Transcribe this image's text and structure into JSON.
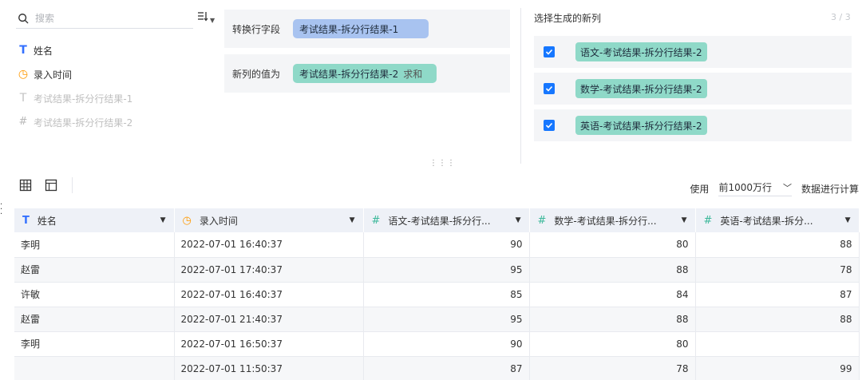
{
  "search": {
    "placeholder": "搜索"
  },
  "fields": [
    {
      "label": "姓名",
      "type": "text-icon"
    },
    {
      "label": "录入时间",
      "type": "clock-icon"
    },
    {
      "label": "考试结果-拆分行结果-1",
      "type": "text-icon"
    },
    {
      "label": "考试结果-拆分行结果-2",
      "type": "number-icon"
    }
  ],
  "config": {
    "pivot_label": "转换行字段",
    "pivot_value": "考试结果-拆分行结果-1",
    "value_label": "新列的值为",
    "value_field": "考试结果-拆分行结果-2",
    "value_agg": "求和"
  },
  "new_columns": {
    "title": "选择生成的新列",
    "count": "3 / 3",
    "items": [
      "语文-考试结果-拆分行结果-2",
      "数学-考试结果-拆分行结果-2",
      "英语-考试结果-拆分行结果-2"
    ]
  },
  "toolbar": {
    "use_label": "使用",
    "rows_value": "前1000万行",
    "suffix": "数据进行计算",
    "drag_glyph": "⋮⋮⋮"
  },
  "table": {
    "headers": [
      "姓名",
      "录入时间",
      "语文-考试结果-拆分行...",
      "数学-考试结果-拆分行...",
      "英语-考试结果-拆分..."
    ],
    "rows": [
      [
        "李明",
        "2022-07-01 16:40:37",
        "90",
        "80",
        "88"
      ],
      [
        "赵雷",
        "2022-07-01 17:40:37",
        "95",
        "88",
        "78"
      ],
      [
        "许敏",
        "2022-07-01 16:40:37",
        "85",
        "84",
        "87"
      ],
      [
        "赵雷",
        "2022-07-01 21:40:37",
        "95",
        "88",
        "88"
      ],
      [
        "李明",
        "2022-07-01 16:50:37",
        "90",
        "80",
        ""
      ],
      [
        "",
        "2022-07-01 11:50:37",
        "87",
        "78",
        "99"
      ]
    ]
  },
  "colors": {
    "accent": "#1677ff",
    "text_icon": "#3370ff",
    "time_icon": "#ff9900",
    "tag_blue": "#a8c3f0",
    "tag_green": "#8fd9c8"
  }
}
